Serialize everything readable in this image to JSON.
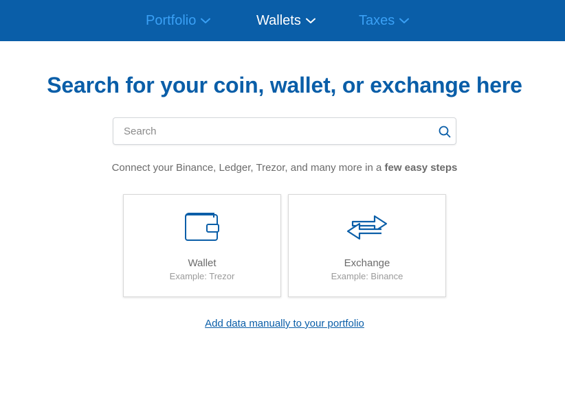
{
  "nav": {
    "items": [
      {
        "label": "Portfolio",
        "icon": "chevron-down-icon",
        "color": "#3aa0f5"
      },
      {
        "label": "Wallets",
        "icon": "chevron-down-icon",
        "color": "#ffffff",
        "active": true
      },
      {
        "label": "Taxes",
        "icon": "chevron-down-icon",
        "color": "#3aa0f5"
      }
    ],
    "background": "#0a5ea8"
  },
  "heading": "Search for your coin, wallet, or exchange here",
  "search": {
    "placeholder": "Search",
    "value": "",
    "icon": "search-icon"
  },
  "subtext": {
    "prefix": "Connect your Binance, Ledger, Trezor, and many more in a ",
    "bold": "few easy steps"
  },
  "cards": [
    {
      "title": "Wallet",
      "example": "Example: Trezor",
      "icon": "wallet-icon"
    },
    {
      "title": "Exchange",
      "example": "Example: Binance",
      "icon": "exchange-arrows-icon"
    }
  ],
  "manual_link": "Add data manually to your portfolio",
  "colors": {
    "brand": "#0a5ea8",
    "nav_link": "#3aa0f5"
  }
}
